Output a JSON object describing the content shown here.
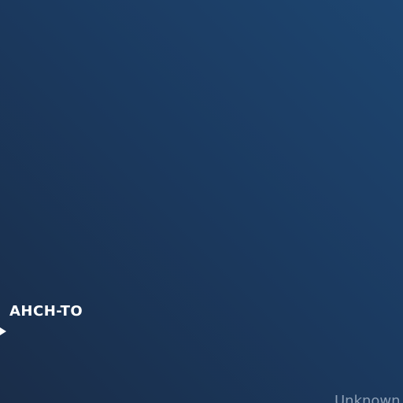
{
  "map": {
    "planet": {
      "name": "AHCH-TO",
      "marker_icon": "triangle-pointer-icon",
      "marker_color": "#ffffff"
    },
    "region_label": "Unknown"
  },
  "colors": {
    "background_dark": "#1a2d49",
    "background_light": "#1d4570",
    "region_text": "#8d9fb5"
  }
}
